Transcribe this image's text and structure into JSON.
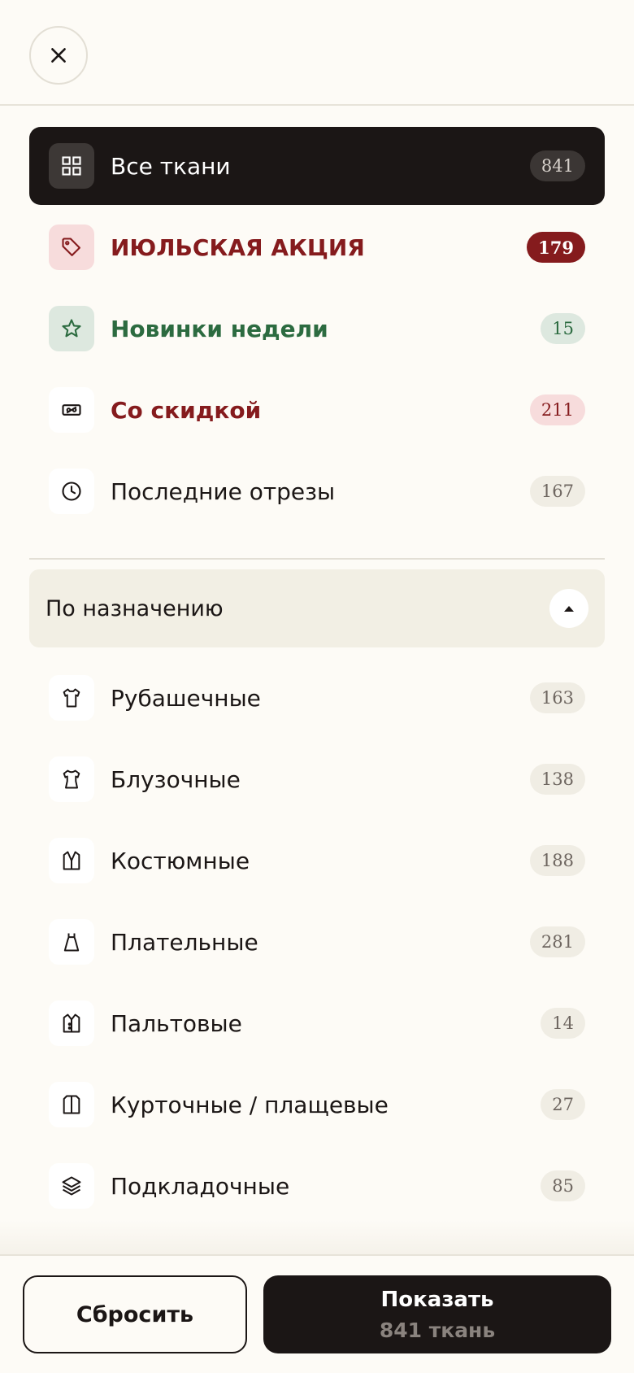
{
  "header": {
    "close_icon": "close-icon"
  },
  "top_items": [
    {
      "key": "all",
      "label": "Все ткани",
      "count": "841",
      "icon": "grid-icon"
    },
    {
      "key": "promo",
      "label": "ИЮЛЬСКАЯ АКЦИЯ",
      "count": "179",
      "icon": "tag-icon"
    },
    {
      "key": "new",
      "label": "Новинки недели",
      "count": "15",
      "icon": "star-icon"
    },
    {
      "key": "sale",
      "label": "Со скидкой",
      "count": "211",
      "icon": "discount-icon"
    },
    {
      "key": "last",
      "label": "Последние отрезы",
      "count": "167",
      "icon": "clock-icon"
    }
  ],
  "section": {
    "title": "По назначению",
    "toggle_icon": "caret-up-icon"
  },
  "purpose_items": [
    {
      "label": "Рубашечные",
      "count": "163",
      "icon": "shirt-icon"
    },
    {
      "label": "Блузочные",
      "count": "138",
      "icon": "blouse-icon"
    },
    {
      "label": "Костюмные",
      "count": "188",
      "icon": "suit-icon"
    },
    {
      "label": "Плательные",
      "count": "281",
      "icon": "dress-icon"
    },
    {
      "label": "Пальтовые",
      "count": "14",
      "icon": "coat-icon"
    },
    {
      "label": "Курточные / плащевые",
      "count": "27",
      "icon": "jacket-icon"
    },
    {
      "label": "Подкладочные",
      "count": "85",
      "icon": "layers-icon"
    }
  ],
  "footer": {
    "reset_label": "Сбросить",
    "show_label": "Показать",
    "show_sub": "841 ткань"
  },
  "colors": {
    "background": "#fdfbf6",
    "dark": "#1b1615",
    "promo_red": "#851b1d",
    "new_green": "#2c6b40",
    "section_bg": "#f2efe4"
  }
}
